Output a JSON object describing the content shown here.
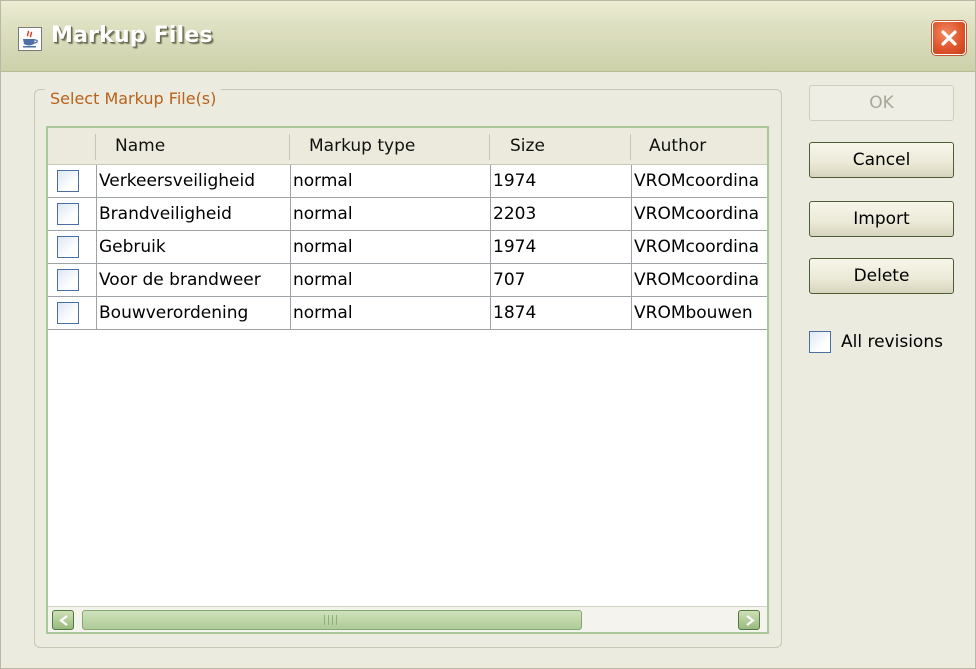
{
  "window": {
    "title": "Markup Files"
  },
  "group": {
    "label": "Select Markup File(s)"
  },
  "table": {
    "columns": [
      "",
      "Name",
      "Markup type",
      "Size",
      "Author"
    ],
    "rows": [
      {
        "checked": false,
        "name": "Verkeersveiligheid",
        "type": "normal",
        "size": "1974",
        "author": "VROMcoordina"
      },
      {
        "checked": false,
        "name": "Brandveiligheid",
        "type": "normal",
        "size": "2203",
        "author": "VROMcoordina"
      },
      {
        "checked": false,
        "name": "Gebruik",
        "type": "normal",
        "size": "1974",
        "author": "VROMcoordina"
      },
      {
        "checked": false,
        "name": "Voor de brandweer",
        "type": "normal",
        "size": "707",
        "author": "VROMcoordina"
      },
      {
        "checked": false,
        "name": "Bouwverordening",
        "type": "normal",
        "size": "1874",
        "author": "VROMbouwen"
      }
    ]
  },
  "buttons": {
    "ok": "OK",
    "cancel": "Cancel",
    "import": "Import",
    "delete": "Delete"
  },
  "options": {
    "all_revisions_label": "All revisions",
    "all_revisions_checked": false
  },
  "colors": {
    "group_label": "#b8621b",
    "close_button": "#e0562d",
    "table_border": "#a9c89a"
  }
}
